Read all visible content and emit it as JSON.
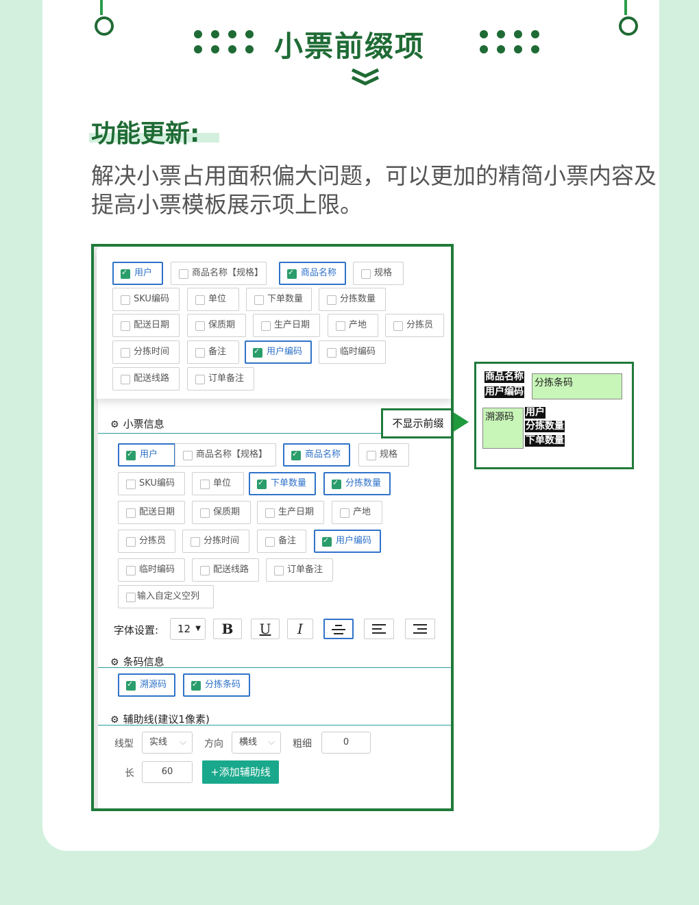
{
  "title": "小票前缀项",
  "subtitle": "功能更新:",
  "description": "解决小票占用面积偏大问题，可以更加的精简小票内容及 提高小票模板展示项上限。",
  "popup": {
    "chips": [
      {
        "label": "用户",
        "on": true
      },
      {
        "label": "商品名称【规格】",
        "on": false
      },
      {
        "label": "商品名称",
        "on": true
      },
      {
        "label": "规格",
        "on": false
      },
      {
        "label": "SKU编码",
        "on": false
      },
      {
        "label": "单位",
        "on": false
      },
      {
        "label": "下单数量",
        "on": false
      },
      {
        "label": "分拣数量",
        "on": false
      },
      {
        "label": "配送日期",
        "on": false
      },
      {
        "label": "保质期",
        "on": false
      },
      {
        "label": "生产日期",
        "on": false
      },
      {
        "label": "产地",
        "on": false
      },
      {
        "label": "分拣员",
        "on": false
      },
      {
        "label": "分拣时间",
        "on": false
      },
      {
        "label": "备注",
        "on": false
      },
      {
        "label": "用户编码",
        "on": true
      },
      {
        "label": "临时编码",
        "on": false
      },
      {
        "label": "配送线路",
        "on": false
      },
      {
        "label": "订单备注",
        "on": false
      }
    ]
  },
  "ticket_info": {
    "label": "小票信息",
    "no_prefix": "不显示前缀",
    "chips": [
      {
        "label": "用户",
        "on": true
      },
      {
        "label": "商品名称【规格】",
        "on": false
      },
      {
        "label": "商品名称",
        "on": true
      },
      {
        "label": "规格",
        "on": false
      },
      {
        "label": "SKU编码",
        "on": false
      },
      {
        "label": "单位",
        "on": false
      },
      {
        "label": "下单数量",
        "on": true
      },
      {
        "label": "分拣数量",
        "on": true
      },
      {
        "label": "配送日期",
        "on": false
      },
      {
        "label": "保质期",
        "on": false
      },
      {
        "label": "生产日期",
        "on": false
      },
      {
        "label": "产地",
        "on": false
      },
      {
        "label": "分拣员",
        "on": false
      },
      {
        "label": "分拣时间",
        "on": false
      },
      {
        "label": "备注",
        "on": false
      },
      {
        "label": "用户编码",
        "on": true
      },
      {
        "label": "临时编码",
        "on": false
      },
      {
        "label": "配送线路",
        "on": false
      },
      {
        "label": "订单备注",
        "on": false
      }
    ],
    "custom_add": "+ 输入自定义空列"
  },
  "font": {
    "label": "字体设置:",
    "size": "12",
    "buttons": [
      "B",
      "U",
      "I"
    ]
  },
  "barcode": {
    "label": "条码信息",
    "chips": [
      {
        "label": "溯源码",
        "on": true
      },
      {
        "label": "分拣条码",
        "on": true
      }
    ]
  },
  "guide": {
    "label": "辅助线(建议1像素)",
    "type_label": "线型",
    "type_value": "实线",
    "dir_label": "方向",
    "dir_value": "横线",
    "thick_label": "粗细",
    "thick_value": "0",
    "len_label": "长",
    "len_value": "60",
    "add_button": "+添加辅助线"
  },
  "ticket_preview": {
    "name_tag": "商品名称",
    "code_tag": "用户编码",
    "sort_code": "分拣条码",
    "trace": "溯源码",
    "user": "用户",
    "sort_qty": "分拣数量",
    "order_qty": "下单数量"
  }
}
